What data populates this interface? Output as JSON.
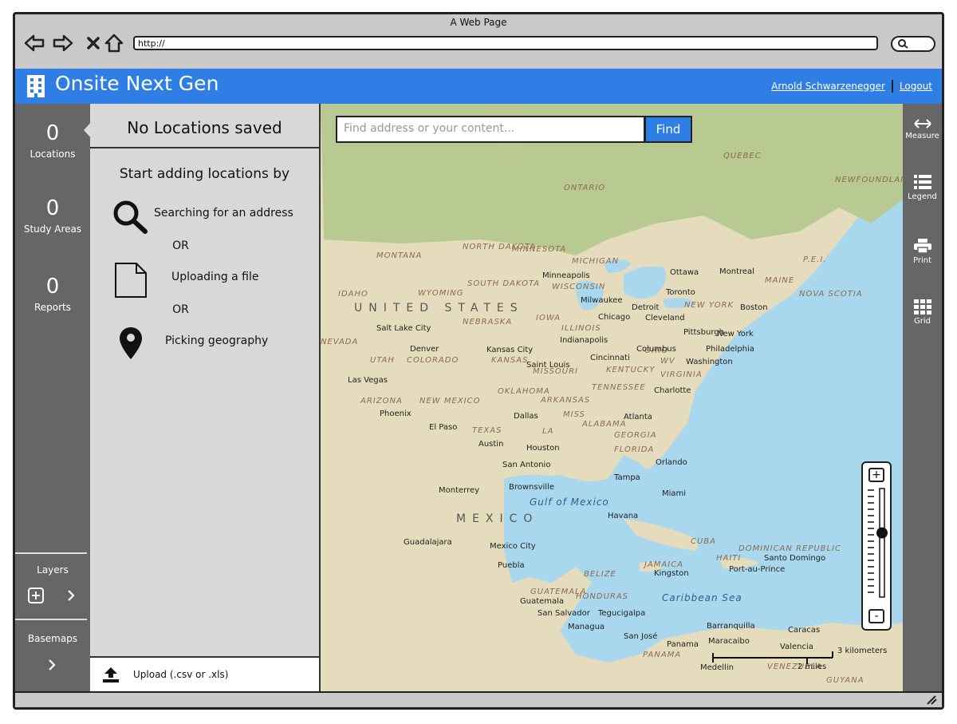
{
  "browser": {
    "window_title": "A Web Page",
    "url": "http://"
  },
  "header": {
    "app_title": "Onsite Next Gen",
    "user_name": "Arnold Schwarzenegger",
    "logout_label": "Logout"
  },
  "left_rail": {
    "stats": [
      {
        "count": "0",
        "label": "Locations"
      },
      {
        "count": "0",
        "label": "Study Areas"
      },
      {
        "count": "0",
        "label": "Reports"
      }
    ],
    "layers_label": "Layers",
    "basemaps_label": "Basemaps"
  },
  "panel": {
    "title": "No Locations saved",
    "subtitle": "Start adding locations by",
    "options": [
      {
        "label": "Searching for an address",
        "icon": "search-icon"
      },
      {
        "label": "Uploading a file",
        "icon": "file-icon"
      },
      {
        "label": "Picking geography",
        "icon": "map-pin-icon"
      }
    ],
    "or_label": "OR",
    "upload_label": "Upload (.csv or .xls)"
  },
  "map": {
    "search_placeholder": "Find address or your content...",
    "find_label": "Find",
    "scale_km": "3 kilometers",
    "scale_mi": "2 miles",
    "labels": {
      "countries": [
        "UNITED STATES",
        "MEXICO"
      ],
      "regions": [
        "QUEBEC",
        "ONTARIO",
        "NEWFOUNDLAND AND LABRA",
        "MONTANA",
        "NORTH DAKOTA",
        "MINNESOTA",
        "MICHIGAN",
        "SOUTH DAKOTA",
        "WISCONSIN",
        "WYOMING",
        "IDAHO",
        "NEBRASKA",
        "IOWA",
        "ILLINOIS",
        "NEW YORK",
        "MAINE",
        "P.E.I.",
        "NOVA SCOTIA",
        "NEVADA",
        "UTAH",
        "COLORADO",
        "KANSAS",
        "MISSOURI",
        "KENTUCKY",
        "OHIO",
        "VIRGINIA",
        "TENNESSEE",
        "OKLAHOMA",
        "ARKANSAS",
        "ARIZONA",
        "NEW MEXICO",
        "TEXAS",
        "MISS",
        "ALABAMA",
        "GEORGIA",
        "FLORIDA",
        "LA",
        "CUBA",
        "BELIZE",
        "GUATEMALA",
        "HONDURAS",
        "JAMAICA",
        "HAITI",
        "DOMINICAN REPUBLIC",
        "PANAMA",
        "VENEZUELA",
        "GUYANA",
        "WV"
      ],
      "cities": [
        "Ottawa",
        "Montreal",
        "Toronto",
        "Boston",
        "Detroit",
        "Cleveland",
        "Minneapolis",
        "Milwaukee",
        "Chicago",
        "Indianapolis",
        "Pittsburgh",
        "New York",
        "Philadelphia",
        "Columbus",
        "Washington",
        "Cincinnati",
        "Salt Lake City",
        "Denver",
        "Kansas City",
        "Saint Louis",
        "Charlotte",
        "Las Vegas",
        "Phoenix",
        "El Paso",
        "Dallas",
        "Atlanta",
        "Austin",
        "Houston",
        "San Antonio",
        "Orlando",
        "Tampa",
        "Miami",
        "Monterrey",
        "Brownsville",
        "Havana",
        "Guadalajara",
        "Mexico City",
        "Puebla",
        "Kingston",
        "Port-au-Prince",
        "Santo Domingo",
        "Guatemala",
        "San Salvador",
        "Tegucigalpa",
        "Managua",
        "San José",
        "Panama",
        "Barranquilla",
        "Maracaibo",
        "Caracas",
        "Valencia",
        "Medellin"
      ],
      "seas": [
        "Gulf of Mexico",
        "Caribbean Sea"
      ]
    },
    "land_color": "#e4dcbc",
    "water_color": "#a8d7ee"
  },
  "right_rail": {
    "tools": [
      {
        "label": "Measure",
        "icon": "measure-icon"
      },
      {
        "label": "Legend",
        "icon": "legend-icon"
      },
      {
        "label": "Print",
        "icon": "print-icon"
      },
      {
        "label": "Grid",
        "icon": "grid-icon"
      }
    ]
  },
  "zoom": {
    "in_label": "+",
    "out_label": "-",
    "level": 0.6
  },
  "colors": {
    "accent": "#2f7ee6",
    "rail": "#666666",
    "panel": "#d8d8d8"
  }
}
